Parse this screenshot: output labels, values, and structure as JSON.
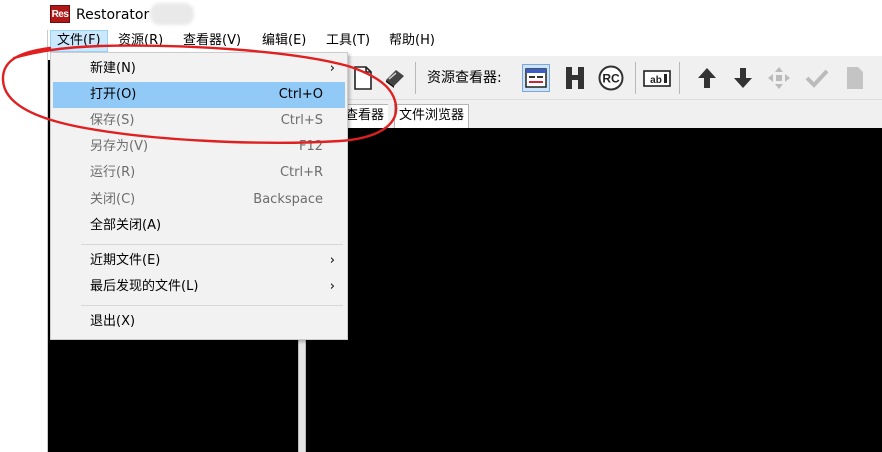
{
  "window": {
    "title": "Restorator",
    "icon_text": "Res"
  },
  "menubar": {
    "items": [
      {
        "label": "文件(F)"
      },
      {
        "label": "资源(R)"
      },
      {
        "label": "查看器(V)"
      },
      {
        "label": "编辑(E)"
      },
      {
        "label": "工具(T)"
      },
      {
        "label": "帮助(H)"
      }
    ]
  },
  "file_menu": {
    "items": [
      {
        "label": "新建(N)",
        "shortcut": "",
        "submenu": "›",
        "state": "normal"
      },
      {
        "label": "打开(O)",
        "shortcut": "Ctrl+O",
        "submenu": "",
        "state": "highlighted"
      },
      {
        "label": "保存(S)",
        "shortcut": "Ctrl+S",
        "submenu": "",
        "state": "disabled"
      },
      {
        "label": "另存为(V)",
        "shortcut": "F12",
        "submenu": "",
        "state": "disabled"
      },
      {
        "label": "运行(R)",
        "shortcut": "Ctrl+R",
        "submenu": "",
        "state": "disabled"
      },
      {
        "label": "关闭(C)",
        "shortcut": "Backspace",
        "submenu": "",
        "state": "disabled"
      },
      {
        "label": "全部关闭(A)",
        "shortcut": "",
        "submenu": "",
        "state": "normal"
      },
      {
        "label": "近期文件(E)",
        "shortcut": "",
        "submenu": "›",
        "state": "normal"
      },
      {
        "label": "最后发现的文件(L)",
        "shortcut": "",
        "submenu": "›",
        "state": "normal"
      },
      {
        "label": "退出(X)",
        "shortcut": "",
        "submenu": "",
        "state": "normal"
      }
    ]
  },
  "toolbar": {
    "viewer_label": "资源查看器:"
  },
  "tabs": [
    {
      "label": "查看器"
    },
    {
      "label": "文件浏览器"
    }
  ],
  "colors": {
    "menu_highlight": "#91c9f7",
    "menubar_active": "#cce8ff",
    "annotation": "#e02020",
    "panel_bg": "#000000"
  }
}
